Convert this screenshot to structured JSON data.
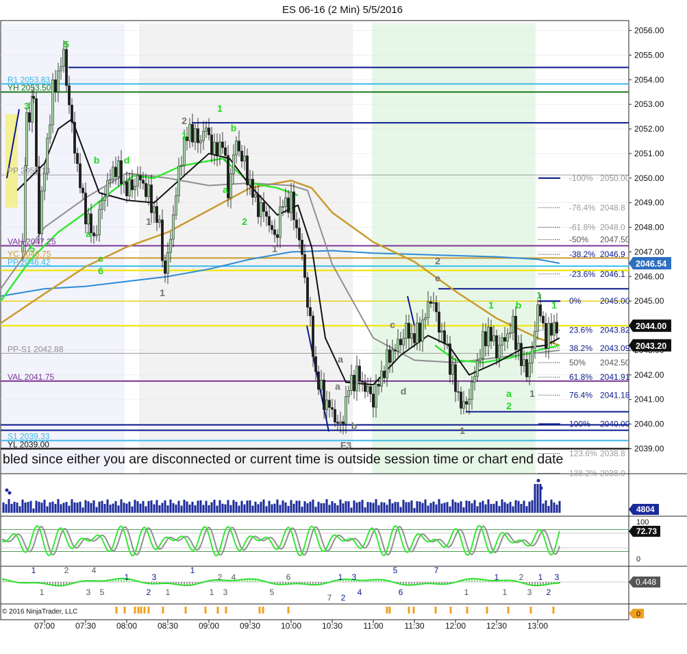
{
  "window": {
    "title": "ES 06-16 (2 Min)  5/5/2016"
  },
  "copyright": "© 2016 NinjaTrader, LLC",
  "session_notice": "bled since either you are disconnected or current time is outside session time or chart end date",
  "colors": {
    "navy": "#0b1a8c",
    "cyan": "#3ab8e8",
    "green": "#1d7a1d",
    "purple": "#7d3594",
    "gold": "#c99a2e",
    "yellow": "#f0e61e",
    "ma_black": "#111111",
    "ma_gray": "#8f8f8f",
    "ma_blue": "#2d8ad6",
    "ma_green": "#33e833",
    "label_green": "#19d919",
    "up_bar": "#9fd49f",
    "down_bar": "#1d1d1d"
  },
  "chart_data": {
    "type": "candlestick",
    "title": "ES 06-16 (2 Min)  5/5/2016",
    "y_range": [
      2038.4,
      2056.5
    ],
    "x_labels": [
      "07:00",
      "07:30",
      "08:00",
      "08:30",
      "09:00",
      "09:30",
      "10:00",
      "10:30",
      "11:00",
      "11:30",
      "12:00",
      "12:30",
      "13:00"
    ],
    "y_ticks": [
      "2039.00",
      "2040.00",
      "2041.00",
      "2042.00",
      "2043.00",
      "2044.00",
      "2045.00",
      "2046.00",
      "2047.00",
      "2048.00",
      "2049.00",
      "2050.00",
      "2051.00",
      "2052.00",
      "2053.00",
      "2054.00",
      "2055.00",
      "2056.00"
    ],
    "price_levels": [
      {
        "label": "R1 2053.83",
        "value": 2053.83,
        "color": "#3ab8e8"
      },
      {
        "label": "YH 2053.50",
        "value": 2053.5,
        "color": "#1d7a1d"
      },
      {
        "label": "PP 2050.13",
        "value": 2050.13,
        "color": "#8f8f8f"
      },
      {
        "label": "VAH 2047.25",
        "value": 2047.25,
        "color": "#7d3594"
      },
      {
        "label": "YC 2046.75",
        "value": 2046.75,
        "color": "#c99a2e"
      },
      {
        "label": "PP 2046.42",
        "value": 2046.42,
        "color": "#3ab8e8"
      },
      {
        "label": "PP-S1 2042.88",
        "value": 2042.88,
        "color": "#8f8f8f"
      },
      {
        "label": "VAL 2041.75",
        "value": 2041.75,
        "color": "#7d3594"
      },
      {
        "label": "S1 2039.33",
        "value": 2039.33,
        "color": "#3ab8e8"
      },
      {
        "label": "YL 2039.00",
        "value": 2039.0,
        "color": "#111111"
      }
    ],
    "fib_levels": [
      {
        "label": "-100%",
        "value": "2050.00"
      },
      {
        "label": "-76.4%",
        "value": "2048.8"
      },
      {
        "label": "-61.8%",
        "value": "2048.0"
      },
      {
        "label": "-50%",
        "value": "2047.50"
      },
      {
        "label": "-38.2%",
        "value": "2046.9"
      },
      {
        "label": "-23.6%",
        "value": "2046.1"
      },
      {
        "label": "0%",
        "value": "2045.00"
      },
      {
        "label": "23.6%",
        "value": "2043.82"
      },
      {
        "label": "38.2%",
        "value": "2043.09"
      },
      {
        "label": "50%",
        "value": "2042.50"
      },
      {
        "label": "61.8%",
        "value": "2041.91"
      },
      {
        "label": "76.4%",
        "value": "2041.18"
      },
      {
        "label": "100%",
        "value": "2040.00"
      },
      {
        "label": "123.6%",
        "value": "2038.8"
      },
      {
        "label": "138.2%",
        "value": "2038.0"
      }
    ],
    "price_markers": [
      {
        "label": "2046.54",
        "value": 2046.54,
        "style": "blue"
      },
      {
        "label": "2044.00",
        "value": 2044.0,
        "style": "black"
      },
      {
        "label": "2043.20",
        "value": 2043.2,
        "style": "black"
      }
    ],
    "ohlc_path": [
      {
        "t": "06:44",
        "p": 2047.0
      },
      {
        "t": "06:47",
        "p": 2052.5
      },
      {
        "t": "06:52",
        "p": 2053.0
      },
      {
        "t": "06:56",
        "p": 2048.0
      },
      {
        "t": "07:02",
        "p": 2051.5
      },
      {
        "t": "07:06",
        "p": 2053.5
      },
      {
        "t": "07:14",
        "p": 2055.0
      },
      {
        "t": "07:20",
        "p": 2052.0
      },
      {
        "t": "07:28",
        "p": 2049.0
      },
      {
        "t": "07:36",
        "p": 2047.5
      },
      {
        "t": "07:44",
        "p": 2049.5
      },
      {
        "t": "07:52",
        "p": 2050.5
      },
      {
        "t": "08:00",
        "p": 2049.5
      },
      {
        "t": "08:10",
        "p": 2050.0
      },
      {
        "t": "08:18",
        "p": 2049.0
      },
      {
        "t": "08:24",
        "p": 2048.0
      },
      {
        "t": "08:28",
        "p": 2046.0
      },
      {
        "t": "08:34",
        "p": 2048.5
      },
      {
        "t": "08:40",
        "p": 2051.0
      },
      {
        "t": "08:46",
        "p": 2052.0
      },
      {
        "t": "08:52",
        "p": 2051.5
      },
      {
        "t": "08:58",
        "p": 2052.0
      },
      {
        "t": "09:04",
        "p": 2051.0
      },
      {
        "t": "09:10",
        "p": 2051.5
      },
      {
        "t": "09:14",
        "p": 2049.5
      },
      {
        "t": "09:20",
        "p": 2051.5
      },
      {
        "t": "09:26",
        "p": 2050.5
      },
      {
        "t": "09:34",
        "p": 2049.0
      },
      {
        "t": "09:42",
        "p": 2048.5
      },
      {
        "t": "09:48",
        "p": 2047.5
      },
      {
        "t": "09:54",
        "p": 2049.0
      },
      {
        "t": "10:00",
        "p": 2049.0
      },
      {
        "t": "10:06",
        "p": 2047.5
      },
      {
        "t": "10:10",
        "p": 2046.0
      },
      {
        "t": "10:14",
        "p": 2044.0
      },
      {
        "t": "10:18",
        "p": 2042.0
      },
      {
        "t": "10:24",
        "p": 2041.0
      },
      {
        "t": "10:30",
        "p": 2040.5
      },
      {
        "t": "10:36",
        "p": 2039.8
      },
      {
        "t": "10:42",
        "p": 2041.5
      },
      {
        "t": "10:48",
        "p": 2042.0
      },
      {
        "t": "10:54",
        "p": 2041.5
      },
      {
        "t": "11:00",
        "p": 2041.0
      },
      {
        "t": "11:06",
        "p": 2042.0
      },
      {
        "t": "11:12",
        "p": 2042.8
      },
      {
        "t": "11:18",
        "p": 2043.2
      },
      {
        "t": "11:24",
        "p": 2043.8
      },
      {
        "t": "11:30",
        "p": 2043.5
      },
      {
        "t": "11:36",
        "p": 2044.0
      },
      {
        "t": "11:42",
        "p": 2045.2
      },
      {
        "t": "11:48",
        "p": 2044.0
      },
      {
        "t": "11:54",
        "p": 2043.0
      },
      {
        "t": "12:00",
        "p": 2041.5
      },
      {
        "t": "12:06",
        "p": 2040.6
      },
      {
        "t": "12:12",
        "p": 2041.5
      },
      {
        "t": "12:18",
        "p": 2043.0
      },
      {
        "t": "12:24",
        "p": 2043.8
      },
      {
        "t": "12:30",
        "p": 2043.0
      },
      {
        "t": "12:36",
        "p": 2043.5
      },
      {
        "t": "12:42",
        "p": 2044.0
      },
      {
        "t": "12:48",
        "p": 2042.5
      },
      {
        "t": "12:54",
        "p": 2042.2
      },
      {
        "t": "13:00",
        "p": 2044.8
      },
      {
        "t": "13:06",
        "p": 2043.5
      },
      {
        "t": "13:12",
        "p": 2044.0
      },
      {
        "t": "13:16",
        "p": 2044.0
      }
    ],
    "wave_labels": [
      {
        "text": "3",
        "t": "06:47",
        "p": 2052.8,
        "color": "green"
      },
      {
        "text": "5",
        "t": "07:16",
        "p": 2055.3,
        "color": "green"
      },
      {
        "text": "a",
        "t": "07:32",
        "p": 2047.6,
        "color": "green"
      },
      {
        "text": "b",
        "t": "07:38",
        "p": 2050.6,
        "color": "green"
      },
      {
        "text": "c",
        "t": "07:41",
        "p": 2046.6,
        "color": "green"
      },
      {
        "text": "6",
        "t": "07:41",
        "p": 2046.1,
        "color": "green"
      },
      {
        "text": "d",
        "t": "08:00",
        "p": 2050.6,
        "color": "green"
      },
      {
        "text": "5",
        "t": "06:51",
        "p": 2047.0,
        "color": "green"
      },
      {
        "text": "1",
        "t": "08:16",
        "p": 2048.1,
        "color": "gray"
      },
      {
        "text": "1",
        "t": "08:26",
        "p": 2045.2,
        "color": "gray"
      },
      {
        "text": "2",
        "t": "08:42",
        "p": 2052.2,
        "color": "gray"
      },
      {
        "text": "1",
        "t": "08:42",
        "p": 2051.6,
        "color": "green"
      },
      {
        "text": "1",
        "t": "09:08",
        "p": 2052.7,
        "color": "green"
      },
      {
        "text": "b",
        "t": "09:18",
        "p": 2051.9,
        "color": "green"
      },
      {
        "text": "a",
        "t": "09:12",
        "p": 2049.4,
        "color": "green"
      },
      {
        "text": "2",
        "t": "09:26",
        "p": 2048.1,
        "color": "green"
      },
      {
        "text": "1",
        "t": "09:48",
        "p": 2047.0,
        "color": "gray"
      },
      {
        "text": "a",
        "t": "10:36",
        "p": 2042.5,
        "color": "gray"
      },
      {
        "text": "a",
        "t": "10:34",
        "p": 2041.4,
        "color": "gray"
      },
      {
        "text": "b",
        "t": "10:46",
        "p": 2039.8,
        "color": "gray"
      },
      {
        "text": "F3",
        "t": "10:40",
        "p": 2039.0,
        "color": "gray"
      },
      {
        "text": "c",
        "t": "11:14",
        "p": 2043.9,
        "color": "gray"
      },
      {
        "text": "d",
        "t": "11:22",
        "p": 2041.2,
        "color": "gray"
      },
      {
        "text": "2",
        "t": "11:47",
        "p": 2046.5,
        "color": "gray"
      },
      {
        "text": "e",
        "t": "11:47",
        "p": 2045.8,
        "color": "gray"
      },
      {
        "text": "1",
        "t": "12:05",
        "p": 2039.6,
        "color": "gray"
      },
      {
        "text": "1",
        "t": "12:26",
        "p": 2044.7,
        "color": "green"
      },
      {
        "text": "b",
        "t": "12:46",
        "p": 2044.7,
        "color": "green"
      },
      {
        "text": "a",
        "t": "12:39",
        "p": 2041.1,
        "color": "green"
      },
      {
        "text": "2",
        "t": "12:39",
        "p": 2040.6,
        "color": "green"
      },
      {
        "text": "1",
        "t": "12:56",
        "p": 2041.1,
        "color": "gray"
      },
      {
        "text": "1",
        "t": "13:01",
        "p": 2045.1,
        "color": "green"
      },
      {
        "text": "1",
        "t": "13:12",
        "p": 2044.7,
        "color": "green"
      }
    ],
    "volume": {
      "last": "4804"
    },
    "stochastic": {
      "last": "72.73",
      "ticks": [
        "100",
        "0"
      ]
    },
    "oscillator": {
      "last": "0.448",
      "labels": [
        {
          "text": "1",
          "t": "06:52",
          "row": "top",
          "color": "navy"
        },
        {
          "text": "2",
          "t": "07:16",
          "row": "top",
          "color": "gray"
        },
        {
          "text": "1",
          "t": "06:58",
          "row": "bottom",
          "color": "gray"
        },
        {
          "text": "3",
          "t": "07:32",
          "row": "bottom",
          "color": "gray"
        },
        {
          "text": "5",
          "t": "07:42",
          "row": "bottom",
          "color": "gray"
        },
        {
          "text": "4",
          "t": "07:36",
          "row": "top",
          "color": "gray"
        },
        {
          "text": "1",
          "t": "08:00",
          "row": "mid",
          "color": "navy"
        },
        {
          "text": "2",
          "t": "08:16",
          "row": "bottom",
          "color": "navy"
        },
        {
          "text": "3",
          "t": "08:20",
          "row": "mid",
          "color": "navy"
        },
        {
          "text": "1",
          "t": "08:30",
          "row": "bottom",
          "color": "gray"
        },
        {
          "text": "1",
          "t": "08:48",
          "row": "top",
          "color": "navy"
        },
        {
          "text": "1",
          "t": "09:02",
          "row": "bottom",
          "color": "gray"
        },
        {
          "text": "2",
          "t": "09:08",
          "row": "mid",
          "color": "gray"
        },
        {
          "text": "3",
          "t": "09:12",
          "row": "bottom",
          "color": "gray"
        },
        {
          "text": "4",
          "t": "09:18",
          "row": "mid",
          "color": "gray"
        },
        {
          "text": "5",
          "t": "09:46",
          "row": "bottom",
          "color": "gray"
        },
        {
          "text": "6",
          "t": "09:58",
          "row": "mid",
          "color": "gray"
        },
        {
          "text": "1",
          "t": "10:36",
          "row": "mid",
          "color": "navy"
        },
        {
          "text": "3",
          "t": "10:46",
          "row": "mid",
          "color": "navy"
        },
        {
          "text": "2",
          "t": "10:38",
          "row": "low",
          "color": "navy"
        },
        {
          "text": "7",
          "t": "10:28",
          "row": "low",
          "color": "gray"
        },
        {
          "text": "4",
          "t": "10:50",
          "row": "bottom",
          "color": "navy"
        },
        {
          "text": "5",
          "t": "11:16",
          "row": "top",
          "color": "navy"
        },
        {
          "text": "6",
          "t": "11:20",
          "row": "bottom",
          "color": "navy"
        },
        {
          "text": "7",
          "t": "11:46",
          "row": "top",
          "color": "navy"
        },
        {
          "text": "1",
          "t": "12:08",
          "row": "bottom",
          "color": "gray"
        },
        {
          "text": "1",
          "t": "12:30",
          "row": "mid",
          "color": "navy"
        },
        {
          "text": "1",
          "t": "12:36",
          "row": "bottom",
          "color": "gray"
        },
        {
          "text": "2",
          "t": "12:48",
          "row": "mid",
          "color": "gray"
        },
        {
          "text": "3",
          "t": "12:54",
          "row": "bottom",
          "color": "gray"
        },
        {
          "text": "1",
          "t": "13:02",
          "row": "mid",
          "color": "navy"
        },
        {
          "text": "2",
          "t": "13:08",
          "row": "bottom",
          "color": "navy"
        },
        {
          "text": "3",
          "t": "13:14",
          "row": "mid",
          "color": "navy"
        }
      ]
    },
    "signal_row": {
      "last": "0"
    }
  }
}
